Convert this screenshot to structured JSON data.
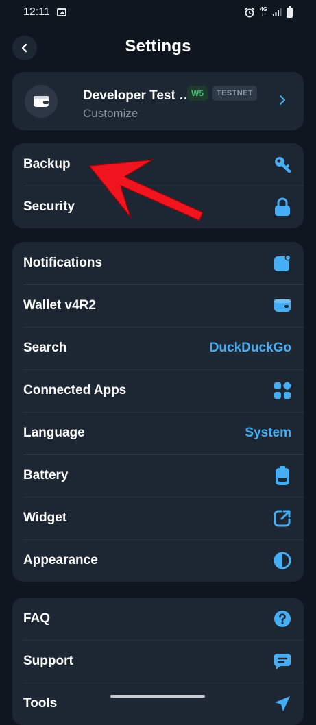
{
  "status_bar": {
    "time": "12:11",
    "network_top": "4G",
    "network_bottom": "↓↑"
  },
  "header": {
    "title": "Settings"
  },
  "wallet": {
    "name": "Developer Test Wallet",
    "subtitle": "Customize",
    "version_badge": "W5",
    "network_badge": "TESTNET"
  },
  "groups": [
    {
      "rows": [
        {
          "label": "Backup",
          "icon": "key-icon"
        },
        {
          "label": "Security",
          "icon": "lock-icon"
        }
      ]
    },
    {
      "rows": [
        {
          "label": "Notifications",
          "icon": "notification-icon"
        },
        {
          "label": "Wallet v4R2",
          "icon": "wallet-icon"
        },
        {
          "label": "Search",
          "value": "DuckDuckGo"
        },
        {
          "label": "Connected Apps",
          "icon": "apps-icon"
        },
        {
          "label": "Language",
          "value": "System"
        },
        {
          "label": "Battery",
          "icon": "battery-icon"
        },
        {
          "label": "Widget",
          "icon": "external-link-icon"
        },
        {
          "label": "Appearance",
          "icon": "contrast-icon"
        }
      ]
    },
    {
      "rows": [
        {
          "label": "FAQ",
          "icon": "question-icon"
        },
        {
          "label": "Support",
          "icon": "message-icon"
        },
        {
          "label": "Tools",
          "icon": "send-icon"
        }
      ]
    }
  ],
  "colors": {
    "background": "#10161f",
    "card": "#1d2633",
    "accent": "#45aef5",
    "badge_green": "#3fc17a",
    "annotation_arrow": "#f0141e"
  }
}
